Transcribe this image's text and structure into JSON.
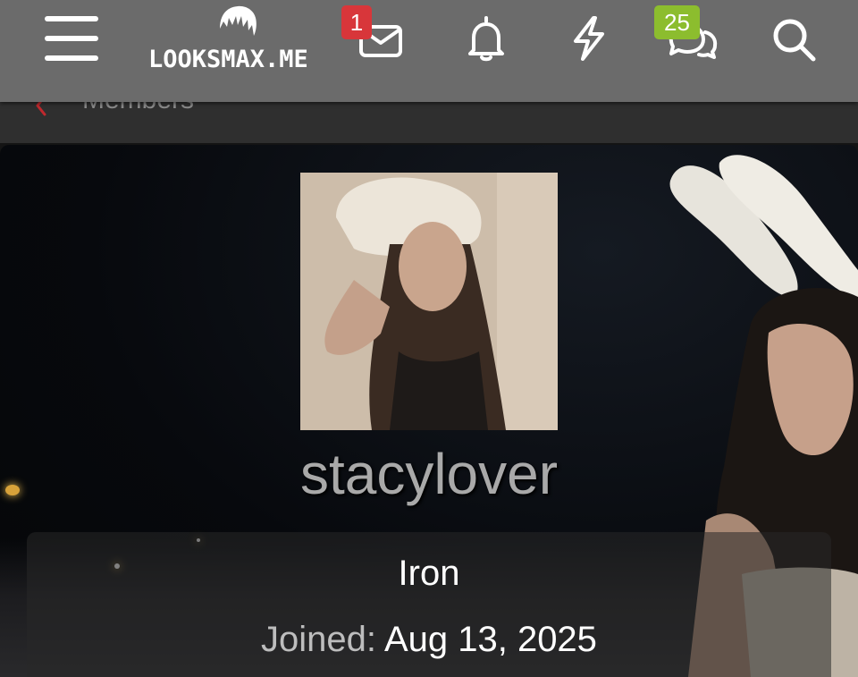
{
  "header": {
    "logo_text": "LOOKSMAX.ME",
    "badges": {
      "messages": "1",
      "chats": "25"
    },
    "icons": [
      "menu-icon",
      "mail-icon",
      "bell-icon",
      "bolt-icon",
      "chat-icon",
      "search-icon"
    ],
    "colors": {
      "bar": "#6b6b6b",
      "badge_red": "#d8363a",
      "badge_green": "#8cbd2e"
    }
  },
  "breadcrumb": {
    "label": "Members",
    "accent": "#c0282d"
  },
  "profile": {
    "username": "stacylover",
    "rank": "Iron",
    "joined_label": "Joined:",
    "joined_date": "Aug 13, 2025"
  }
}
